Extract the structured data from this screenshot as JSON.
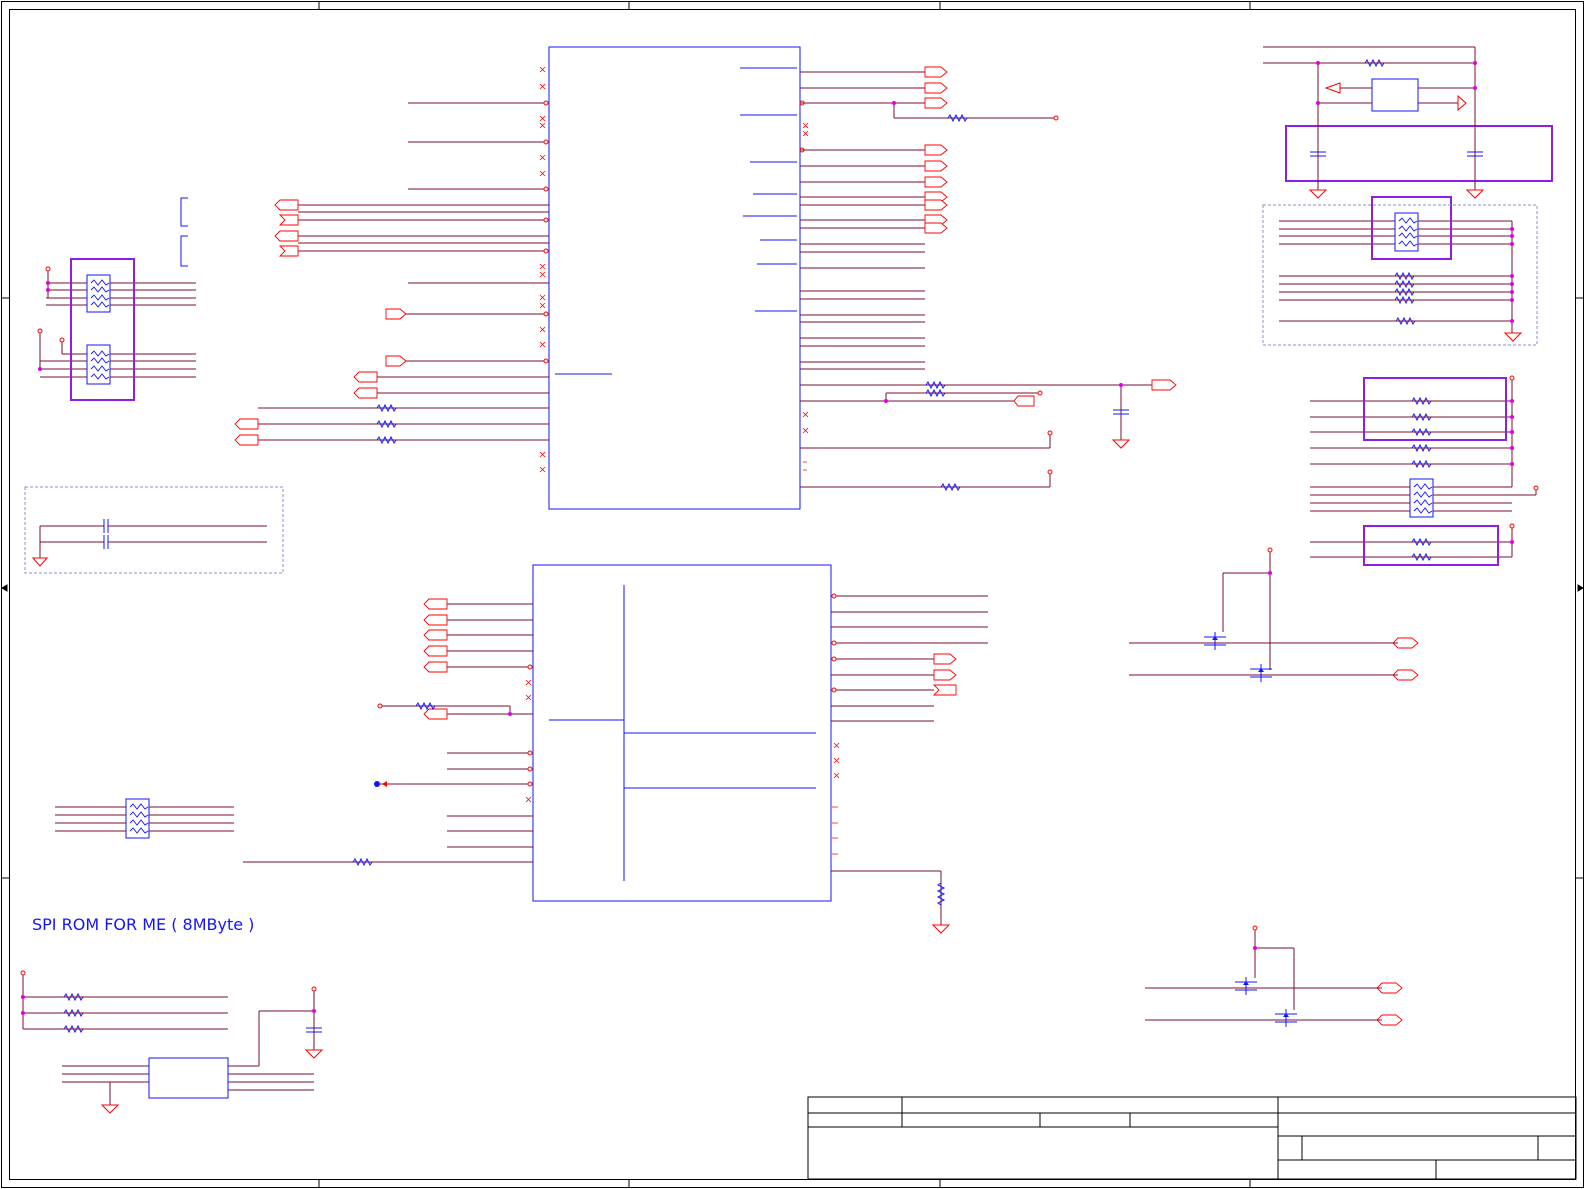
{
  "sheet": {
    "section_caption": "SPI ROM FOR ME ( 8MByte )"
  },
  "colors": {
    "frame": "#000000",
    "net_wire": "#7a1030",
    "power_symbol": "#ff0000",
    "component_outline": "#1414ff",
    "highlight_box": "#8c1ee6",
    "junction": "#e000e0",
    "group_box": "#8c8cd0"
  },
  "components": [
    {
      "name": "pch-upper-block",
      "kind": "ic"
    },
    {
      "name": "pch-lower-block",
      "kind": "ic"
    },
    {
      "name": "spi-rom-chip",
      "kind": "ic"
    },
    {
      "name": "voltage-regulator",
      "kind": "ic"
    },
    {
      "name": "mosfet-upper-pair",
      "kind": "transistor"
    },
    {
      "name": "mosfet-lower-pair",
      "kind": "transistor"
    },
    {
      "name": "resistor-arrays",
      "kind": "resistor-network"
    }
  ],
  "title_block": {
    "fields": []
  }
}
